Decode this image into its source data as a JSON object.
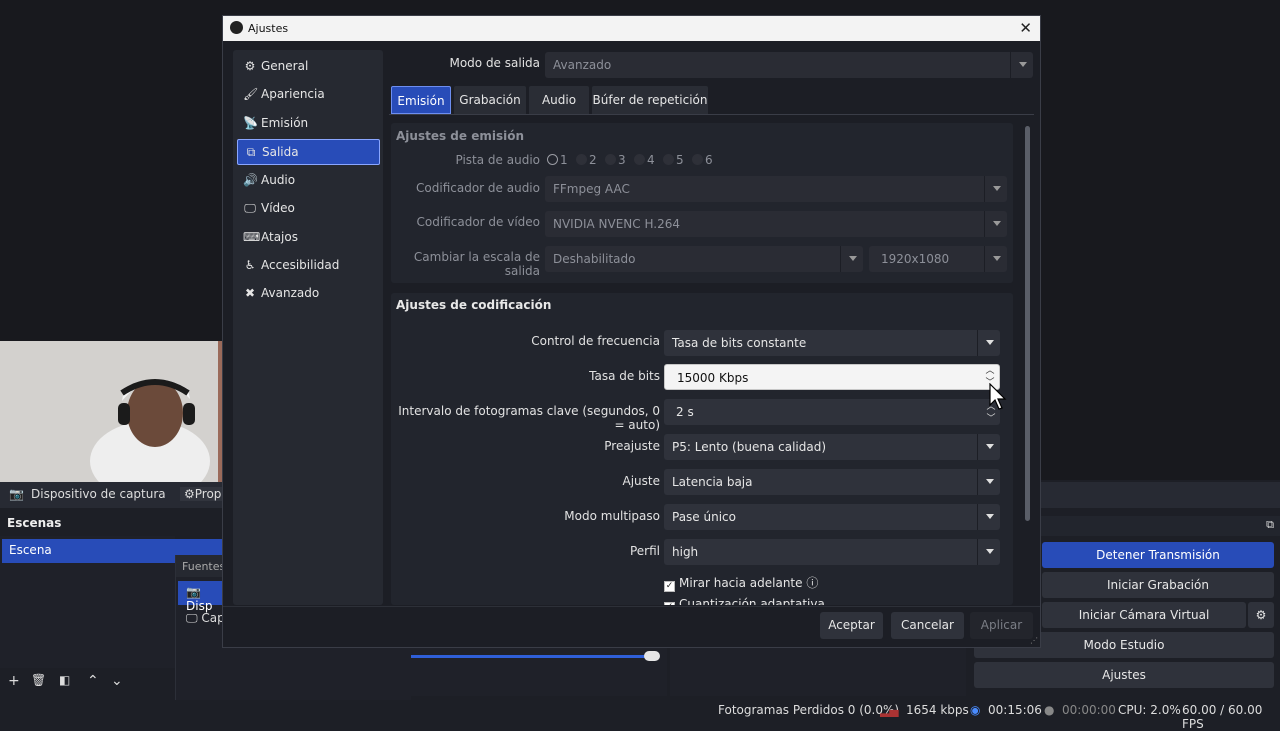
{
  "dialog": {
    "title": "Ajustes",
    "nav": [
      {
        "label": "General",
        "icon": "gear-icon",
        "glyph": "⚙"
      },
      {
        "label": "Apariencia",
        "icon": "brush-icon",
        "glyph": "🖌"
      },
      {
        "label": "Emisión",
        "icon": "broadcast-icon",
        "glyph": "📡"
      },
      {
        "label": "Salida",
        "icon": "output-icon",
        "glyph": "⧉"
      },
      {
        "label": "Audio",
        "icon": "speaker-icon",
        "glyph": "🔊"
      },
      {
        "label": "Vídeo",
        "icon": "monitor-icon",
        "glyph": "🖵"
      },
      {
        "label": "Atajos",
        "icon": "keyboard-icon",
        "glyph": "⌨"
      },
      {
        "label": "Accesibilidad",
        "icon": "accessibility-icon",
        "glyph": "♿"
      },
      {
        "label": "Avanzado",
        "icon": "tools-icon",
        "glyph": "✖"
      }
    ],
    "output_mode_label": "Modo de salida",
    "output_mode_value": "Avanzado",
    "tabs": [
      "Emisión",
      "Grabación",
      "Audio",
      "Búfer de repetición"
    ],
    "stream_group": {
      "title": "Ajustes de emisión",
      "audio_track_label": "Pista de audio",
      "audio_tracks": [
        "1",
        "2",
        "3",
        "4",
        "5",
        "6"
      ],
      "audio_encoder_label": "Codificador de audio",
      "audio_encoder_value": "FFmpeg AAC",
      "video_encoder_label": "Codificador de vídeo",
      "video_encoder_value": "NVIDIA NVENC H.264",
      "rescale_label": "Cambiar la escala de salida",
      "rescale_value": "Deshabilitado",
      "resolution_value": "1920x1080"
    },
    "encode_group": {
      "title": "Ajustes de codificación",
      "rate_control_label": "Control de frecuencia",
      "rate_control_value": "Tasa de bits constante",
      "bitrate_label": "Tasa de bits",
      "bitrate_value": "15000 Kbps",
      "keyframe_label": "Intervalo de fotogramas clave (segundos, 0 = auto)",
      "keyframe_value": "2 s",
      "preset_label": "Preajuste",
      "preset_value": "P5: Lento (buena calidad)",
      "tuning_label": "Ajuste",
      "tuning_value": "Latencia baja",
      "multipass_label": "Modo multipaso",
      "multipass_value": "Pase único",
      "profile_label": "Perfil",
      "profile_value": "high",
      "lookahead_label": "Mirar hacia adelante",
      "adaptive_label": "Cuantización adaptativa"
    },
    "buttons": {
      "accept": "Aceptar",
      "cancel": "Cancelar",
      "apply": "Aplicar"
    }
  },
  "main": {
    "source_name": "Dispositivo de captura de v",
    "props_label": "Prop",
    "scenes_title": "Escenas",
    "scene_item": "Escena",
    "sources_title": "Fuentes",
    "source_items": [
      "Disp",
      "Cap"
    ],
    "controls": {
      "stop_stream": "Detener Transmisión",
      "start_recording": "Iniciar Grabación",
      "start_virtual_cam": "Iniciar Cámara Virtual",
      "studio_mode": "Modo Estudio",
      "settings": "Ajustes"
    },
    "status": {
      "dropped_frames": "Fotogramas Perdidos 0 (0.0%)",
      "bitrate": "1654 kbps",
      "stream_time": "00:15:06",
      "rec_time": "00:00:00",
      "cpu": "CPU: 2.0%",
      "fps": "60.00 / 60.00 FPS"
    }
  },
  "colors": {
    "accent": "#284cb8",
    "dialog_bg": "#1c1e25",
    "panel_bg": "#22252d"
  }
}
